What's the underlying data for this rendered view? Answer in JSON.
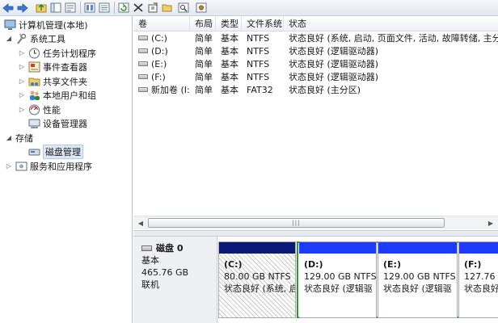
{
  "toolbar": {
    "buttons": [
      "back-arrow-icon",
      "forward-arrow-icon",
      "up-folder-icon",
      "show-hide-tree-icon",
      "help-icon",
      "properties-icon",
      "refresh-icon",
      "delete-icon",
      "export-icon",
      "open-folder-icon",
      "search-icon",
      "settings-icon"
    ]
  },
  "tree": {
    "root": "计算机管理(本地)",
    "system_tools": "系统工具",
    "task_scheduler": "任务计划程序",
    "event_viewer": "事件查看器",
    "shared_folders": "共享文件夹",
    "local_users": "本地用户和组",
    "performance": "性能",
    "device_manager": "设备管理器",
    "storage": "存储",
    "disk_management": "磁盘管理",
    "services_apps": "服务和应用程序"
  },
  "list": {
    "columns": [
      "卷",
      "布局",
      "类型",
      "文件系统",
      "状态"
    ],
    "rows": [
      {
        "volume": "(C:)",
        "layout": "简单",
        "type": "基本",
        "fs": "NTFS",
        "status": "状态良好 (系统, 启动, 页面文件, 活动, 故障转储, 主分区)"
      },
      {
        "volume": "(D:)",
        "layout": "简单",
        "type": "基本",
        "fs": "NTFS",
        "status": "状态良好 (逻辑驱动器)"
      },
      {
        "volume": "(E:)",
        "layout": "简单",
        "type": "基本",
        "fs": "NTFS",
        "status": "状态良好 (逻辑驱动器)"
      },
      {
        "volume": "(F:)",
        "layout": "简单",
        "type": "基本",
        "fs": "NTFS",
        "status": "状态良好 (逻辑驱动器)"
      },
      {
        "volume": "新加卷 (I:)",
        "layout": "简单",
        "type": "基本",
        "fs": "FAT32",
        "status": "状态良好 (主分区)"
      }
    ],
    "scroll_grip": "|||"
  },
  "disk": {
    "name": "磁盘 0",
    "type": "基本",
    "size": "465.76 GB",
    "state": "联机",
    "partitions": [
      {
        "label": "(C:)",
        "size": "80.00 GB NTFS",
        "status": "状态良好 (系统, 启"
      },
      {
        "label": "(D:)",
        "size": "129.00 GB NTFS",
        "status": "状态良好 (逻辑驱"
      },
      {
        "label": "(E:)",
        "size": "129.00 GB NTFS",
        "status": "状态良好 (逻辑驱"
      },
      {
        "label": "(F:)",
        "size": "127.76 G",
        "status": "状态良好"
      }
    ]
  },
  "colors": {
    "primary_partition_bar": "#0b1a78",
    "logical_partition_bar": "#1c3bff",
    "extended_border": "#2a9a2a"
  }
}
